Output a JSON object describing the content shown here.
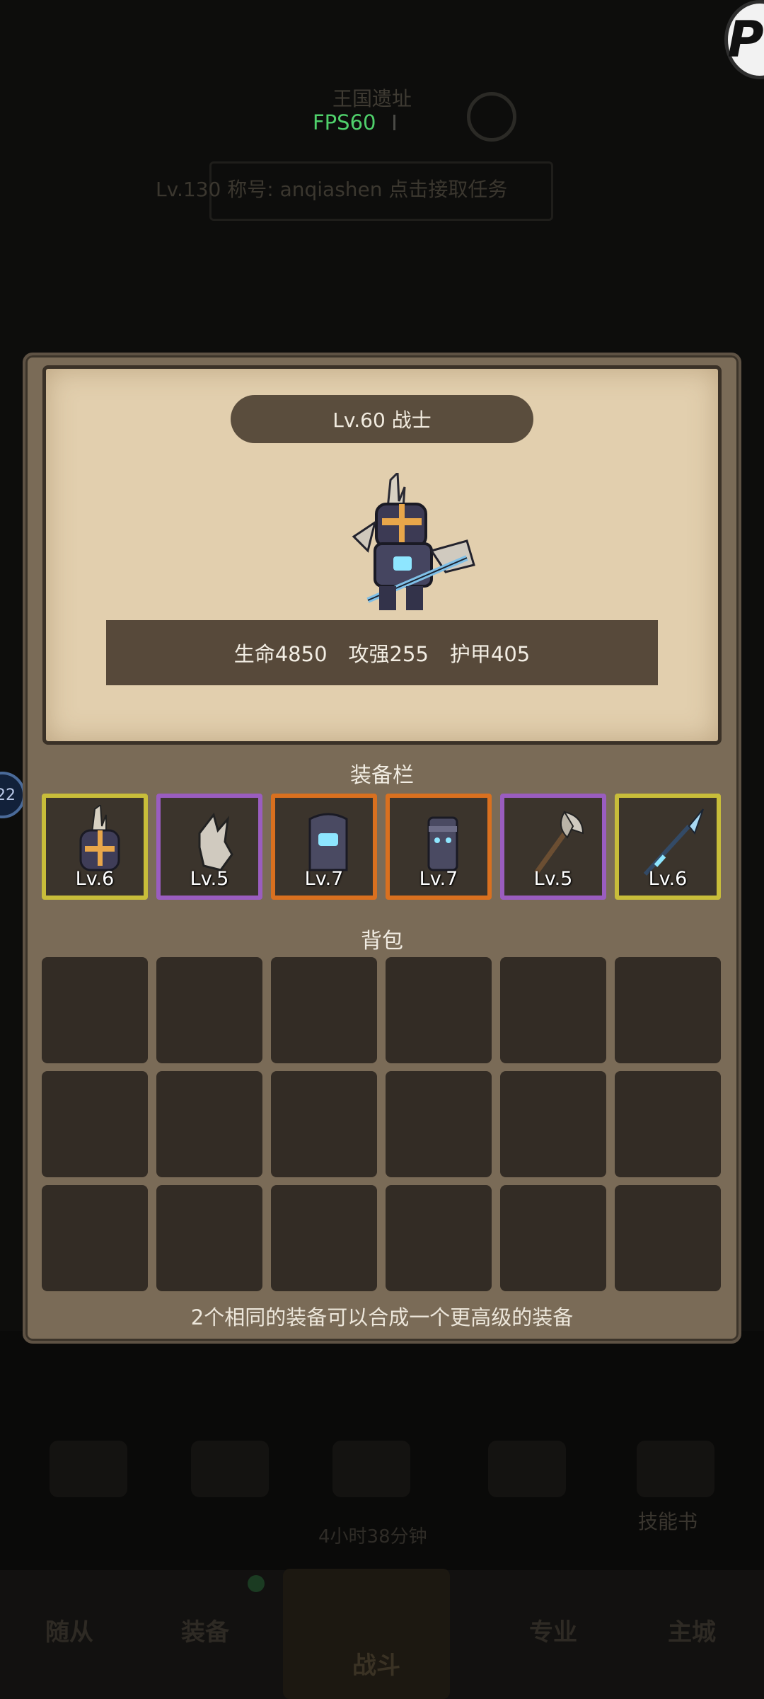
{
  "background": {
    "title": "王国遗址",
    "info_text": "Lv.130 称号: anqiashen 点击接取任务",
    "timer": "4小时38分钟",
    "skill_book": "技能书",
    "nav": [
      "随从",
      "装备",
      "战斗",
      "专业",
      "主城"
    ],
    "side_bubble": "22",
    "corner_badge": "P"
  },
  "fps": "FPS60",
  "hero": {
    "title": "Lv.60 战士",
    "stats": [
      {
        "label": "生命4850"
      },
      {
        "label": "攻强255"
      },
      {
        "label": "护甲405"
      }
    ]
  },
  "equipment": {
    "section_label": "装备栏",
    "slots": [
      {
        "level": "Lv.6",
        "rarity": "gold",
        "icon": "helmet-icon"
      },
      {
        "level": "Lv.5",
        "rarity": "purple",
        "icon": "gauntlet-icon"
      },
      {
        "level": "Lv.7",
        "rarity": "orange",
        "icon": "chest-armor-icon"
      },
      {
        "level": "Lv.7",
        "rarity": "orange",
        "icon": "leg-armor-icon"
      },
      {
        "level": "Lv.5",
        "rarity": "purple",
        "icon": "axe-icon"
      },
      {
        "level": "Lv.6",
        "rarity": "gold",
        "icon": "spear-icon"
      }
    ]
  },
  "backpack": {
    "section_label": "背包",
    "tip": "2个相同的装备可以合成一个更高级的装备"
  },
  "colors": {
    "gold": "#c8bd3a",
    "purple": "#9a5dbf",
    "orange": "#d9701f",
    "fps_green": "#4fd06b"
  }
}
